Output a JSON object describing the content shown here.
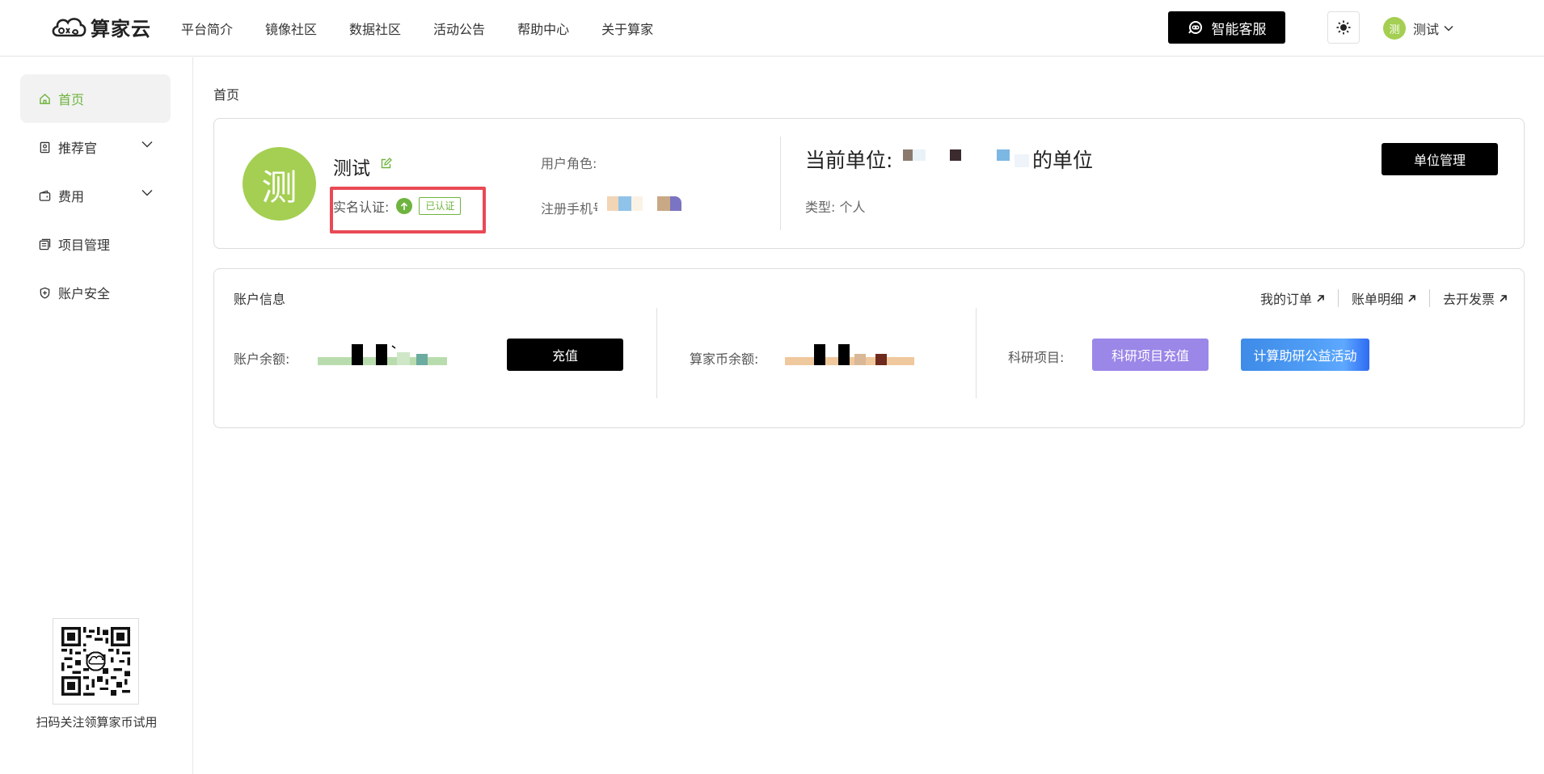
{
  "header": {
    "brand": "算家云",
    "nav": [
      "平台简介",
      "镜像社区",
      "数据社区",
      "活动公告",
      "帮助中心",
      "关于算家"
    ],
    "customer_service": "智能客服",
    "user_initial": "测",
    "user_name": "测试",
    "icons": [
      "smart-cs-icon",
      "sun-icon",
      "chevron-down-icon"
    ]
  },
  "sidebar": {
    "items": [
      {
        "label": "首页",
        "icon": "home-icon",
        "active": true
      },
      {
        "label": "推荐官",
        "icon": "badge-icon",
        "expandable": true
      },
      {
        "label": "费用",
        "icon": "wallet-icon",
        "expandable": true
      },
      {
        "label": "项目管理",
        "icon": "project-icon"
      },
      {
        "label": "账户安全",
        "icon": "shield-icon"
      }
    ],
    "qr_caption": "扫码关注领算家币试用"
  },
  "breadcrumb": "首页",
  "profile": {
    "avatar_initial": "测",
    "name": "测试",
    "realname_label": "实名认证:",
    "verified_tag": "已认证",
    "role_label": "用户角色:",
    "phone_label": "注册手机号",
    "unit_label": "当前单位:",
    "unit_suffix": "的单位",
    "type_label": "类型:",
    "type_value": "个人",
    "unit_manage_button": "单位管理"
  },
  "account": {
    "title": "账户信息",
    "links": [
      "我的订单",
      "账单明细",
      "去开发票"
    ],
    "balance_label": "账户余额:",
    "recharge_button": "充值",
    "coin_label": "算家币余额:",
    "research_label": "科研项目:",
    "research_button": "科研项目充值",
    "activity_button": "计算助研公益活动"
  },
  "colors": {
    "accent_green": "#6fb43f",
    "avatar_green": "#a4cf52",
    "highlight_red": "#e84a55",
    "purple": "#9b87e8",
    "blue": "#3e8be8"
  }
}
